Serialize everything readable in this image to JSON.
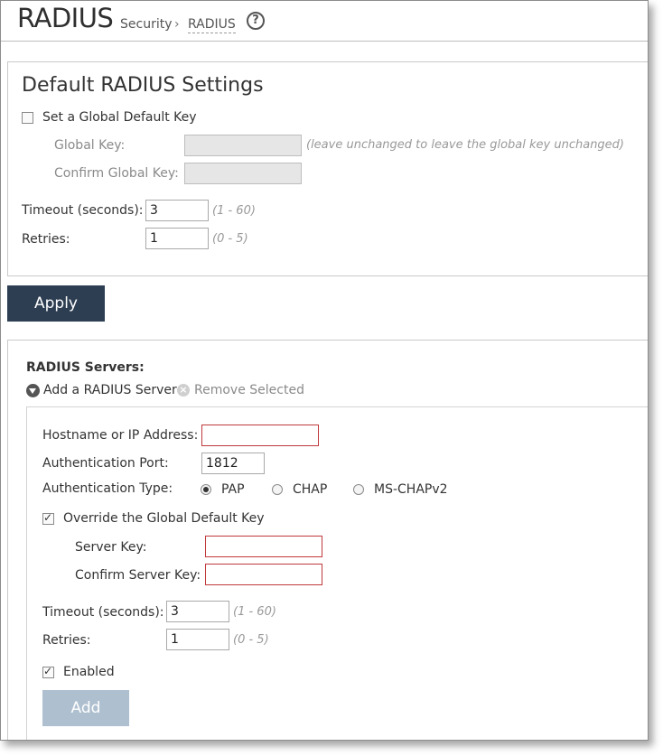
{
  "header": {
    "title": "RADIUS",
    "breadcrumb": [
      "Security",
      "RADIUS"
    ],
    "separator": "›",
    "help_icon": "help-circle-icon"
  },
  "defaults": {
    "heading": "Default RADIUS Settings",
    "set_global_key": {
      "label": "Set a Global Default Key",
      "checked": false
    },
    "global_key": {
      "label": "Global Key:",
      "value": "",
      "hint": "(leave unchanged to leave the global key unchanged)"
    },
    "confirm_global_key": {
      "label": "Confirm Global Key:",
      "value": ""
    },
    "timeout": {
      "label": "Timeout (seconds):",
      "value": "3",
      "hint": "(1 - 60)"
    },
    "retries": {
      "label": "Retries:",
      "value": "1",
      "hint": "(0 - 5)"
    },
    "apply_label": "Apply"
  },
  "servers": {
    "heading": "RADIUS Servers:",
    "add_label": "Add a RADIUS Server",
    "remove_label": "Remove Selected",
    "form": {
      "hostname": {
        "label": "Hostname or IP Address:",
        "value": ""
      },
      "auth_port": {
        "label": "Authentication Port:",
        "value": "1812"
      },
      "auth_type": {
        "label": "Authentication Type:",
        "options": [
          "PAP",
          "CHAP",
          "MS-CHAPv2"
        ],
        "selected": "PAP"
      },
      "override": {
        "label": "Override the Global Default Key",
        "checked": true
      },
      "server_key": {
        "label": "Server Key:",
        "value": ""
      },
      "confirm_server_key": {
        "label": "Confirm Server Key:",
        "value": ""
      },
      "timeout": {
        "label": "Timeout (seconds):",
        "value": "3",
        "hint": "(1 - 60)"
      },
      "retries": {
        "label": "Retries:",
        "value": "1",
        "hint": "(0 - 5)"
      },
      "enabled": {
        "label": "Enabled",
        "checked": true
      },
      "add_label": "Add"
    }
  },
  "colors": {
    "primary_button": "#2e3e52",
    "disabled_button": "#aebfcf",
    "error_border": "#c0393b"
  }
}
